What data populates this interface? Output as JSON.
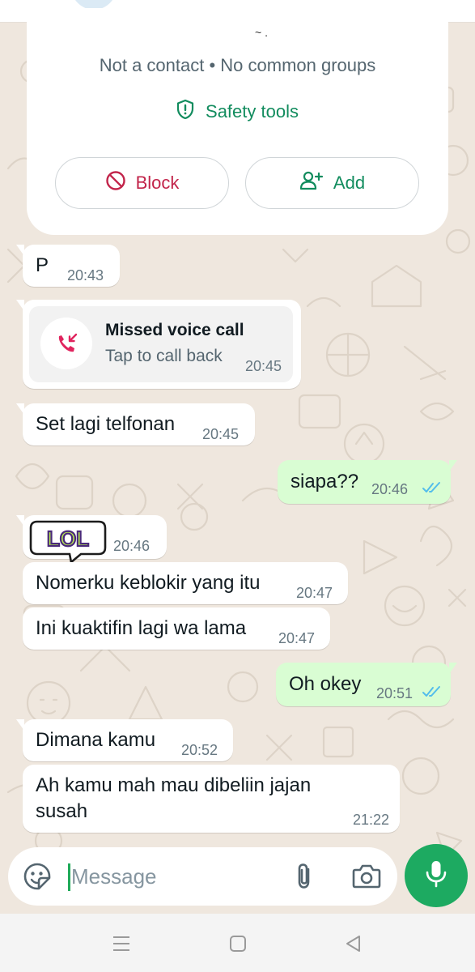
{
  "info_card": {
    "mark": "~ .",
    "subtitle": "Not a contact • No common groups",
    "safety_label": "Safety tools",
    "block_label": "Block",
    "add_label": "Add"
  },
  "messages": [
    {
      "dir": "in",
      "text": "P",
      "time": "20:43"
    },
    {
      "dir": "in",
      "type": "call",
      "title": "Missed voice call",
      "subtitle": "Tap to call back",
      "time": "20:45"
    },
    {
      "dir": "in",
      "text": "Set lagi telfonan",
      "time": "20:45"
    },
    {
      "dir": "out",
      "text": "siapa??",
      "time": "20:46",
      "status": "read"
    },
    {
      "dir": "in",
      "type": "sticker",
      "sticker_text": "LOL",
      "time": "20:46"
    },
    {
      "dir": "in",
      "text": "Nomerku keblokir yang itu",
      "time": "20:47"
    },
    {
      "dir": "in",
      "text": "Ini kuaktifin lagi wa lama",
      "time": "20:47"
    },
    {
      "dir": "out",
      "text": "Oh okey",
      "time": "20:51",
      "status": "read"
    },
    {
      "dir": "in",
      "text": "Dimana kamu",
      "time": "20:52"
    },
    {
      "dir": "in",
      "text_line1": "Ah kamu mah mau dibeliin jajan",
      "text_line2": "susah",
      "time": "21:22"
    }
  ],
  "composer": {
    "placeholder": "Message",
    "value": ""
  },
  "colors": {
    "accent_green": "#1daa61",
    "outgoing_bubble": "#d9fdd3",
    "incoming_bubble": "#ffffff",
    "read_ticks": "#53bdeb",
    "block_red": "#c2244a",
    "missed_call_red": "#e0245e",
    "wallpaper": "#efe7de"
  },
  "icons": [
    "shield-icon",
    "block-icon",
    "add-contact-icon",
    "missed-call-icon",
    "double-check-icon",
    "sticker-icon",
    "paperclip-icon",
    "camera-icon",
    "mic-icon",
    "menu-icon",
    "home-icon",
    "back-icon"
  ]
}
